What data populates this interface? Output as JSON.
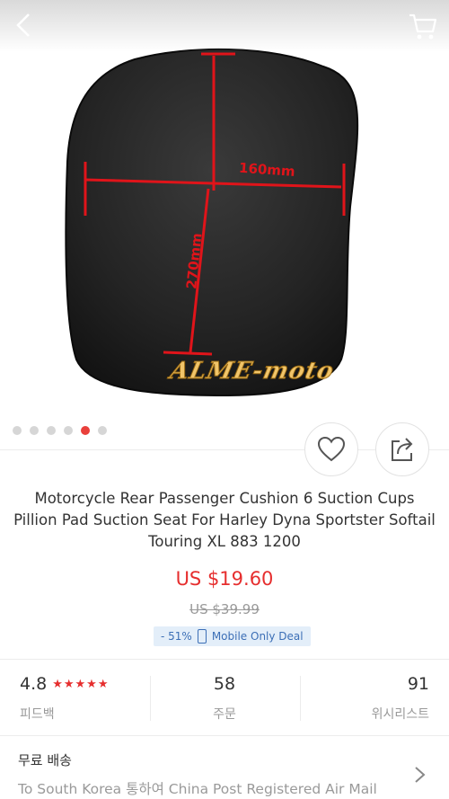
{
  "header": {
    "back_icon": "chevron-left-icon",
    "cart_icon": "shopping-cart-icon"
  },
  "image": {
    "dim_width_label": "160mm",
    "dim_height_label": "270mm",
    "watermark": "ALME-moto",
    "carousel_total": 6,
    "carousel_active_index": 4
  },
  "actions": {
    "favorite_icon": "heart-outline-icon",
    "share_icon": "share-icon"
  },
  "product": {
    "title": "Motorcycle Rear Passenger Cushion 6 Suction Cups Pillion Pad Suction Seat For Harley Dyna Sportster Softail Touring XL 883 1200",
    "price": "US $19.60",
    "original_price": "US $39.99",
    "discount": "- 51%",
    "deal_label": "Mobile Only Deal"
  },
  "stats": {
    "rating": "4.8",
    "stars": "★★★★★",
    "feedback_label": "피드백",
    "orders": "58",
    "orders_label": "주문",
    "wishlist": "91",
    "wishlist_label": "위시리스트"
  },
  "shipping": {
    "title": "무료 배송",
    "description": "To South Korea 통하여 China Post Registered Air Mail"
  },
  "colors": {
    "accent": "#e62e2e",
    "deal_bg": "#e3eef9",
    "deal_text": "#3c6fb6"
  }
}
